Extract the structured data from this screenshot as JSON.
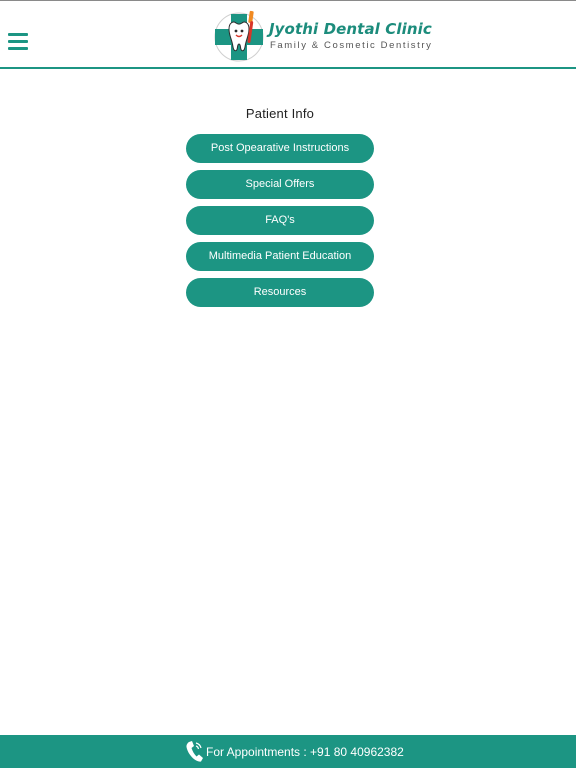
{
  "header": {
    "logo": {
      "title": "Jyothi Dental Clinic",
      "subtitle": "Family & Cosmetic Dentistry",
      "emblem_icon": "dental-cross-toothbrush-icon"
    },
    "menu_icon": "hamburger-menu-icon"
  },
  "main": {
    "section_title": "Patient Info",
    "items": [
      {
        "label": "Post Opearative Instructions"
      },
      {
        "label": "Special Offers"
      },
      {
        "label": "FAQ's"
      },
      {
        "label": "Multimedia Patient Education"
      },
      {
        "label": "Resources"
      }
    ]
  },
  "footer": {
    "icon": "phone-icon",
    "text": "For Appointments : +91 80 40962382"
  },
  "colors": {
    "accent": "#1c9583",
    "background": "#ffffff",
    "button_text": "#ffffff",
    "title_text": "#222222",
    "logo_red": "#d8362a",
    "logo_orange": "#f08a22"
  }
}
